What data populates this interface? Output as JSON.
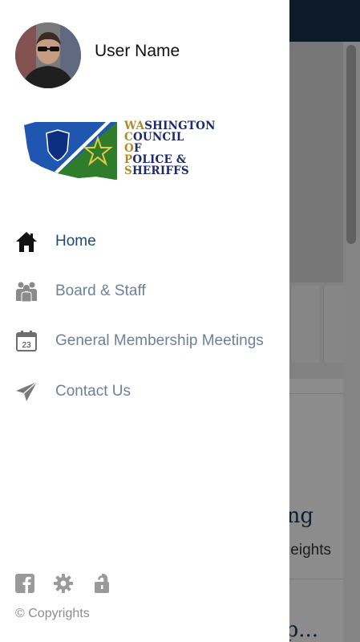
{
  "background_app": {
    "heading_partial": "ng",
    "subtext_partial": "eights",
    "heading2_partial": "p..."
  },
  "drawer": {
    "user": {
      "name": "User Name",
      "avatar": "user-photo"
    },
    "logo": {
      "lines": [
        "WASHINGTON",
        "COUNCIL",
        "OF",
        "POLICE &",
        "SHERIFFS"
      ],
      "initials_color": "#b18a2c",
      "text_color": "#1b2a6b"
    },
    "menu": [
      {
        "label": "Home",
        "icon": "home-icon",
        "active": true
      },
      {
        "label": "Board & Staff",
        "icon": "group-icon",
        "active": false
      },
      {
        "label": "General Membership Meetings",
        "icon": "calendar-icon",
        "calendar_day": "23",
        "active": false
      },
      {
        "label": "Contact Us",
        "icon": "send-icon",
        "active": false
      }
    ],
    "footer": {
      "icons": [
        "facebook-icon",
        "settings-icon",
        "lock-icon"
      ],
      "copyright": "© Copyrights"
    }
  },
  "colors": {
    "topbar": "#19304a",
    "menu_active": "#1f4a73",
    "menu_inactive": "#6d8199",
    "icon_gray": "#8a8a8a"
  }
}
